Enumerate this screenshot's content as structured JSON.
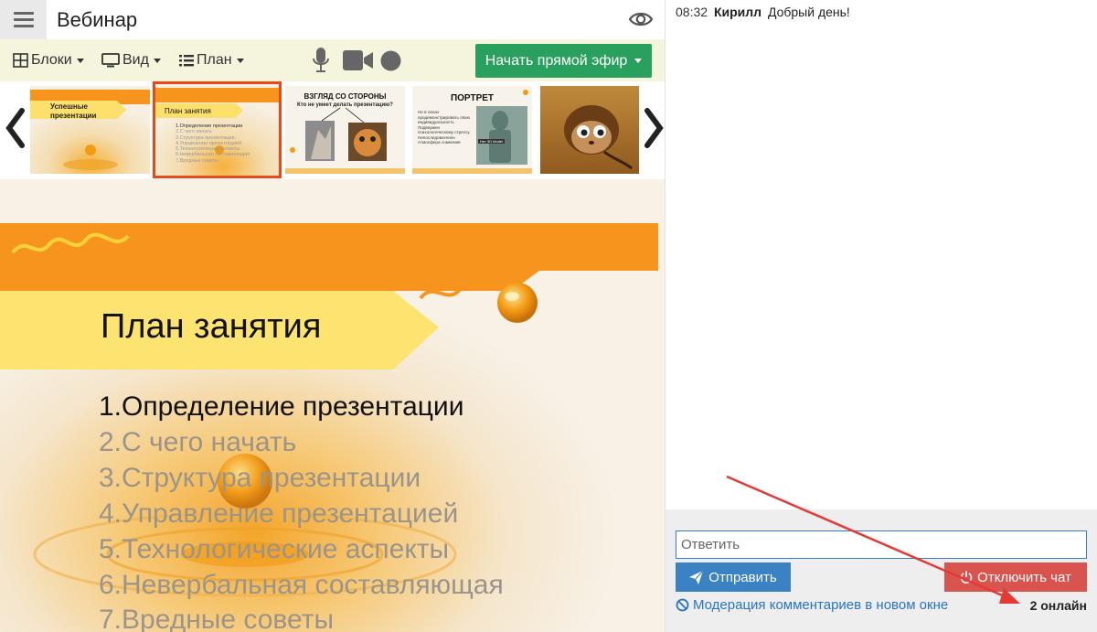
{
  "header": {
    "title": "Вебинар",
    "menu_icon": "hamburger-icon",
    "visibility_icon": "eye-icon"
  },
  "toolbar": {
    "blocks_label": "Блоки",
    "view_label": "Вид",
    "plan_label": "План",
    "live_label": "Начать прямой эфир"
  },
  "thumbnails": [
    {
      "title": "Успешные презентации",
      "lines": []
    },
    {
      "title": "План занятия",
      "lines": [
        "1.Определение презентации",
        "2.С чего начать",
        "3.Структура презентации",
        "4.Управление презентацией",
        "5.Технологические аспекты",
        "6.Невербальная составляющая",
        "7.Вредные советы"
      ],
      "selected": true
    },
    {
      "title": "ВЗГЛЯД СО СТОРОНЫ",
      "subtitle": "Кто не умеет делать презентацию?",
      "lines": []
    },
    {
      "title": "ПОРТРЕТ",
      "lines": [
        "Не в силах продемонстрировать свою индивидуальность",
        "Подвержен психологическому стрессу",
        "Непоследователен",
        "Атмосфера сомнения"
      ],
      "badge": "Нет 3D Model"
    },
    {
      "title": "",
      "lines": []
    }
  ],
  "slide": {
    "title": "План занятия",
    "items": [
      "1.Определение презентации",
      "2.С чего начать",
      "3.Структура презентации",
      "4.Управление презентацией",
      "5.Технологические аспекты",
      "6.Невербальная составляющая",
      "7.Вредные советы"
    ],
    "active_index": 0
  },
  "chat": {
    "messages": [
      {
        "time": "08:32",
        "author": "Кирилл",
        "text": "Добрый день!"
      }
    ],
    "reply_placeholder": "Ответить",
    "send_label": "Отправить",
    "disable_label": "Отключить чат",
    "moderation_label": "Модерация комментариев в новом окне",
    "online_label": "2 онлайн"
  },
  "colors": {
    "accent_green": "#2aa05f",
    "send_blue": "#3b82c4",
    "disable_red": "#d9534f",
    "selected_outline": "#e64a19",
    "slide_orange": "#f7941d"
  }
}
